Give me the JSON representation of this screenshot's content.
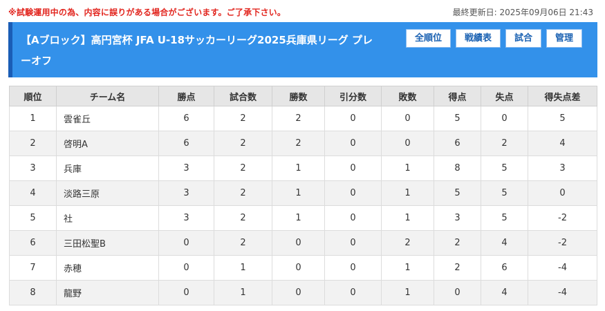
{
  "notice": "※試験運用中の為、内容に誤りがある場合がございます。ご了承下さい。",
  "updated": "最終更新日: 2025年09月06日 21:43",
  "header": {
    "title": "【Aブロック】高円宮杯 JFA U-18サッカーリーグ2025兵庫県リーグ プレーオフ",
    "nav": [
      "全順位",
      "戦績表",
      "試合",
      "管理"
    ]
  },
  "table": {
    "columns": [
      "順位",
      "チーム名",
      "勝点",
      "試合数",
      "勝数",
      "引分数",
      "敗数",
      "得点",
      "失点",
      "得失点差"
    ],
    "rows": [
      [
        "1",
        "雲雀丘",
        "6",
        "2",
        "2",
        "0",
        "0",
        "5",
        "0",
        "5"
      ],
      [
        "2",
        "啓明A",
        "6",
        "2",
        "2",
        "0",
        "0",
        "6",
        "2",
        "4"
      ],
      [
        "3",
        "兵庫",
        "3",
        "2",
        "1",
        "0",
        "1",
        "8",
        "5",
        "3"
      ],
      [
        "4",
        "淡路三原",
        "3",
        "2",
        "1",
        "0",
        "1",
        "5",
        "5",
        "0"
      ],
      [
        "5",
        "社",
        "3",
        "2",
        "1",
        "0",
        "1",
        "3",
        "5",
        "-2"
      ],
      [
        "6",
        "三田松聖B",
        "0",
        "2",
        "0",
        "0",
        "2",
        "2",
        "4",
        "-2"
      ],
      [
        "7",
        "赤穂",
        "0",
        "1",
        "0",
        "0",
        "1",
        "2",
        "6",
        "-4"
      ],
      [
        "8",
        "龍野",
        "0",
        "1",
        "0",
        "0",
        "1",
        "0",
        "4",
        "-4"
      ]
    ]
  }
}
